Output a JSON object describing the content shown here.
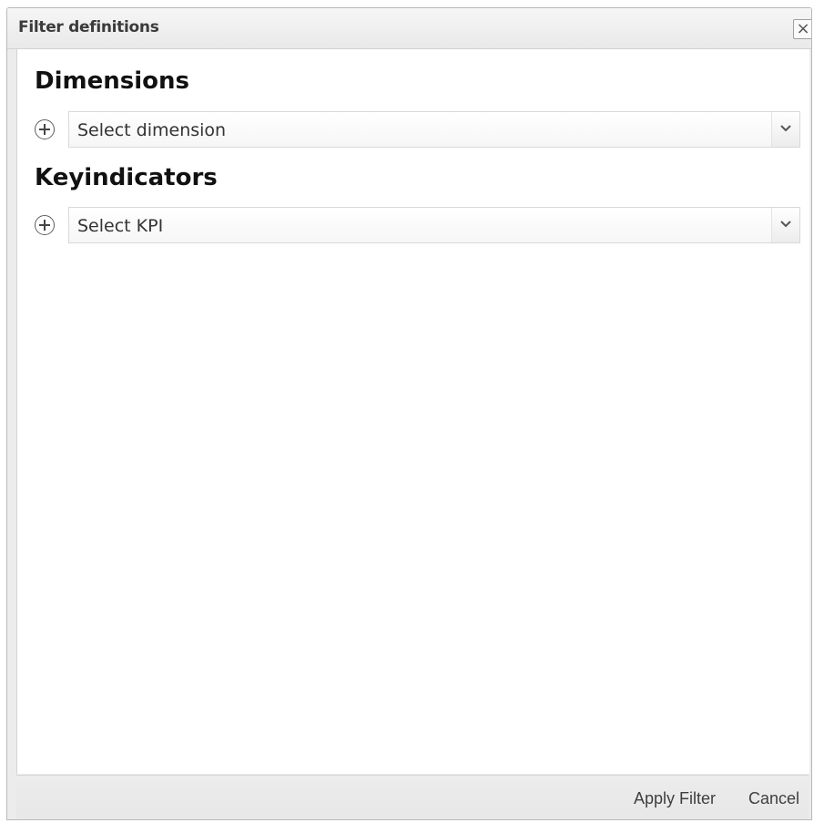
{
  "dialog": {
    "title": "Filter definitions",
    "close_label": "×"
  },
  "dimensions": {
    "heading": "Dimensions",
    "select_value": "Select dimension"
  },
  "keyindicators": {
    "heading": "Keyindicators",
    "select_value": "Select KPI"
  },
  "footer": {
    "apply_label": "Apply Filter",
    "cancel_label": "Cancel"
  },
  "icons": {
    "add": "plus-circle-icon",
    "dropdown": "chevron-down-icon",
    "close": "close-icon"
  }
}
